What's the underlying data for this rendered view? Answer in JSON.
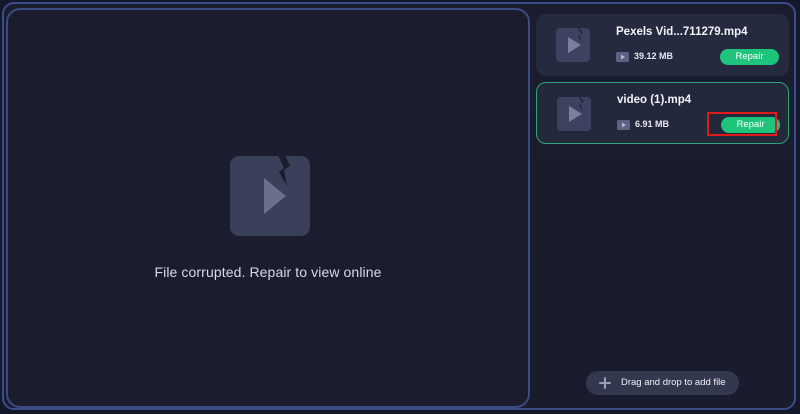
{
  "preview": {
    "message": "File corrupted. Repair to view online",
    "icon": "broken-video-icon"
  },
  "files": [
    {
      "name": "Pexels Vid...711279.mp4",
      "size": "39.12 MB",
      "repair_label": "Repair",
      "selected": false
    },
    {
      "name": "video (1).mp4",
      "size": "6.91 MB",
      "repair_label": "Repair",
      "selected": true
    }
  ],
  "add_file": {
    "label": "Drag and drop to add file",
    "icon": "plus-icon"
  },
  "colors": {
    "accent_green": "#1fc47c",
    "selected_border": "#2fa17b",
    "highlight_red": "#e01919",
    "background": "#1b1d2e"
  }
}
